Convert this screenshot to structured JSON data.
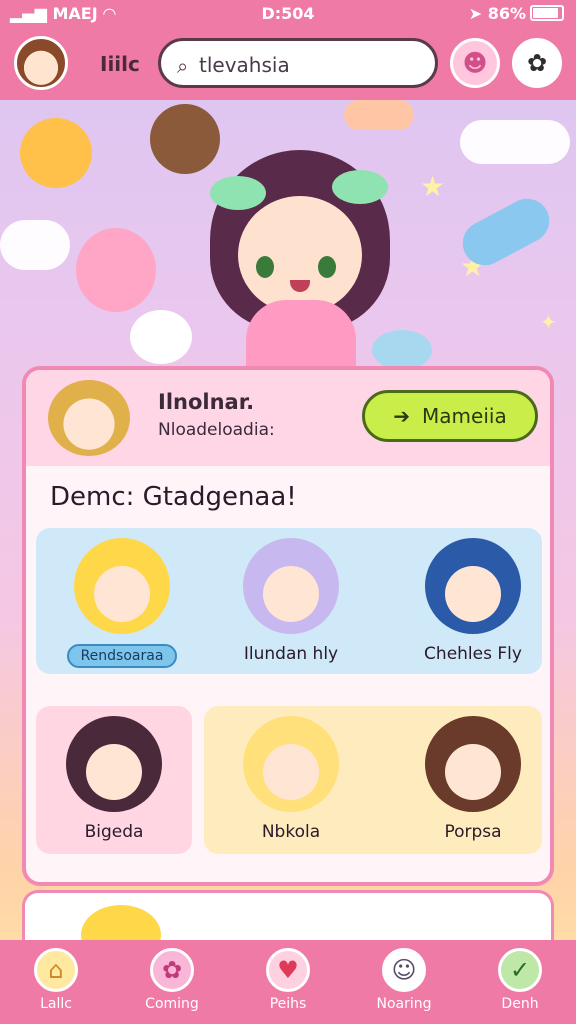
{
  "status_bar": {
    "carrier": "MAEJ",
    "time": "D:504",
    "battery": "86%"
  },
  "header": {
    "app_title": "Iiilc",
    "search_value": "tlevahsia",
    "search_icon": "search-icon",
    "face_button_icon": "smiley-face-icon",
    "settings_button_icon": "gear-icon"
  },
  "card": {
    "name": "Ilnolnar.",
    "status": "Nloadeloadia:",
    "action_label": "Mameiia",
    "action_icon": "arrow-right-icon",
    "heading": "Demc: Gtadgenaa!",
    "characters": [
      {
        "label": "Rendsoaraa",
        "hair": "#ffd84a",
        "selected": true
      },
      {
        "label": "Ilundan hly",
        "hair": "#c8b8f0",
        "selected": false
      },
      {
        "label": "Chehles Fly",
        "hair": "#2a5aa8",
        "selected": false
      },
      {
        "label": "Bigeda",
        "hair": "#4a2a3a",
        "selected": false
      },
      {
        "label": "Nbkola",
        "hair": "#ffe07a",
        "selected": false
      },
      {
        "label": "Porpsa",
        "hair": "#6a3a2a",
        "selected": false
      }
    ]
  },
  "bottom_nav": {
    "items": [
      {
        "label": "Lallc",
        "icon": "home-icon",
        "bg": "#ffe8a0",
        "glyph": "⌂"
      },
      {
        "label": "Coming",
        "icon": "puzzle-icon",
        "bg": "#f9b6d6",
        "glyph": "✿"
      },
      {
        "label": "Peihs",
        "icon": "heart-check-icon",
        "bg": "#ffd0e0",
        "glyph": "♥"
      },
      {
        "label": "Noaring",
        "icon": "ghost-face-icon",
        "bg": "#ffffff",
        "glyph": "☺"
      },
      {
        "label": "Denh",
        "icon": "chart-icon",
        "bg": "#bfe8a8",
        "glyph": "✓"
      }
    ]
  }
}
